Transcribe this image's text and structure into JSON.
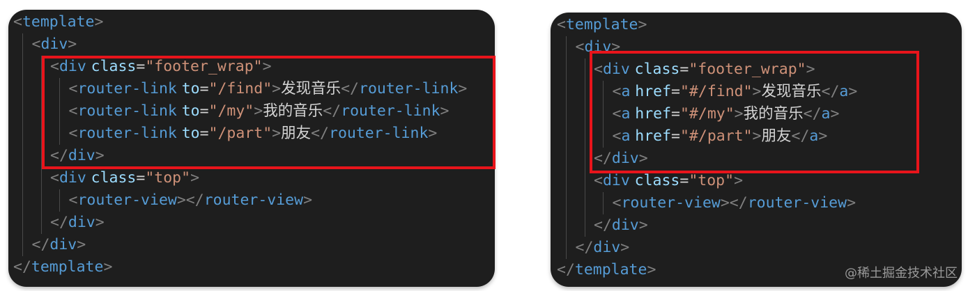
{
  "panels": {
    "left": {
      "lines": [
        {
          "indent": 0,
          "tokens": [
            {
              "t": "tag-bracket",
              "v": "<"
            },
            {
              "t": "tag-name",
              "v": "template"
            },
            {
              "t": "tag-bracket",
              "v": ">"
            }
          ]
        },
        {
          "indent": 1,
          "tokens": [
            {
              "t": "tag-bracket",
              "v": "<"
            },
            {
              "t": "tag-name",
              "v": "div"
            },
            {
              "t": "tag-bracket",
              "v": ">"
            }
          ]
        },
        {
          "indent": 2,
          "tokens": [
            {
              "t": "tag-bracket",
              "v": "<"
            },
            {
              "t": "tag-name",
              "v": "div"
            },
            {
              "t": "text",
              "v": " "
            },
            {
              "t": "attr-name",
              "v": "class"
            },
            {
              "t": "eq",
              "v": "="
            },
            {
              "t": "attr-value",
              "v": "\"footer_wrap\""
            },
            {
              "t": "tag-bracket",
              "v": ">"
            }
          ]
        },
        {
          "indent": 3,
          "tokens": [
            {
              "t": "tag-bracket",
              "v": "<"
            },
            {
              "t": "tag-name",
              "v": "router-link"
            },
            {
              "t": "text",
              "v": " "
            },
            {
              "t": "attr-name",
              "v": "to"
            },
            {
              "t": "eq",
              "v": "="
            },
            {
              "t": "attr-value",
              "v": "\"/find\""
            },
            {
              "t": "tag-bracket",
              "v": ">"
            },
            {
              "t": "text",
              "v": "发现音乐"
            },
            {
              "t": "tag-bracket",
              "v": "</"
            },
            {
              "t": "tag-name",
              "v": "router-link"
            },
            {
              "t": "tag-bracket",
              "v": ">"
            }
          ]
        },
        {
          "indent": 3,
          "tokens": [
            {
              "t": "tag-bracket",
              "v": "<"
            },
            {
              "t": "tag-name",
              "v": "router-link"
            },
            {
              "t": "text",
              "v": " "
            },
            {
              "t": "attr-name",
              "v": "to"
            },
            {
              "t": "eq",
              "v": "="
            },
            {
              "t": "attr-value",
              "v": "\"/my\""
            },
            {
              "t": "tag-bracket",
              "v": ">"
            },
            {
              "t": "text",
              "v": "我的音乐"
            },
            {
              "t": "tag-bracket",
              "v": "</"
            },
            {
              "t": "tag-name",
              "v": "router-link"
            },
            {
              "t": "tag-bracket",
              "v": ">"
            }
          ]
        },
        {
          "indent": 3,
          "tokens": [
            {
              "t": "tag-bracket",
              "v": "<"
            },
            {
              "t": "tag-name",
              "v": "router-link"
            },
            {
              "t": "text",
              "v": " "
            },
            {
              "t": "attr-name",
              "v": "to"
            },
            {
              "t": "eq",
              "v": "="
            },
            {
              "t": "attr-value",
              "v": "\"/part\""
            },
            {
              "t": "tag-bracket",
              "v": ">"
            },
            {
              "t": "text",
              "v": "朋友"
            },
            {
              "t": "tag-bracket",
              "v": "</"
            },
            {
              "t": "tag-name",
              "v": "router-link"
            },
            {
              "t": "tag-bracket",
              "v": ">"
            }
          ]
        },
        {
          "indent": 2,
          "tokens": [
            {
              "t": "tag-bracket",
              "v": "</"
            },
            {
              "t": "tag-name",
              "v": "div"
            },
            {
              "t": "tag-bracket",
              "v": ">"
            }
          ]
        },
        {
          "indent": 2,
          "tokens": [
            {
              "t": "tag-bracket",
              "v": "<"
            },
            {
              "t": "tag-name",
              "v": "div"
            },
            {
              "t": "text",
              "v": " "
            },
            {
              "t": "attr-name",
              "v": "class"
            },
            {
              "t": "eq",
              "v": "="
            },
            {
              "t": "attr-value",
              "v": "\"top\""
            },
            {
              "t": "tag-bracket",
              "v": ">"
            }
          ]
        },
        {
          "indent": 3,
          "tokens": [
            {
              "t": "tag-bracket",
              "v": "<"
            },
            {
              "t": "tag-name",
              "v": "router-view"
            },
            {
              "t": "tag-bracket",
              "v": "></"
            },
            {
              "t": "tag-name",
              "v": "router-view"
            },
            {
              "t": "tag-bracket",
              "v": ">"
            }
          ]
        },
        {
          "indent": 2,
          "tokens": [
            {
              "t": "tag-bracket",
              "v": "</"
            },
            {
              "t": "tag-name",
              "v": "div"
            },
            {
              "t": "tag-bracket",
              "v": ">"
            }
          ]
        },
        {
          "indent": 1,
          "tokens": [
            {
              "t": "tag-bracket",
              "v": "</"
            },
            {
              "t": "tag-name",
              "v": "div"
            },
            {
              "t": "tag-bracket",
              "v": ">"
            }
          ]
        },
        {
          "indent": 0,
          "tokens": [
            {
              "t": "tag-bracket",
              "v": "</"
            },
            {
              "t": "tag-name",
              "v": "template"
            },
            {
              "t": "tag-bracket",
              "v": ">"
            }
          ]
        }
      ]
    },
    "right": {
      "lines": [
        {
          "indent": 0,
          "tokens": [
            {
              "t": "tag-bracket",
              "v": "<"
            },
            {
              "t": "tag-name",
              "v": "template"
            },
            {
              "t": "tag-bracket",
              "v": ">"
            }
          ]
        },
        {
          "indent": 1,
          "tokens": [
            {
              "t": "tag-bracket",
              "v": "<"
            },
            {
              "t": "tag-name",
              "v": "div"
            },
            {
              "t": "tag-bracket",
              "v": ">"
            }
          ]
        },
        {
          "indent": 2,
          "tokens": [
            {
              "t": "tag-bracket",
              "v": "<"
            },
            {
              "t": "tag-name",
              "v": "div"
            },
            {
              "t": "text",
              "v": " "
            },
            {
              "t": "attr-name",
              "v": "class"
            },
            {
              "t": "eq",
              "v": "="
            },
            {
              "t": "attr-value",
              "v": "\"footer_wrap\""
            },
            {
              "t": "tag-bracket",
              "v": ">"
            }
          ]
        },
        {
          "indent": 3,
          "tokens": [
            {
              "t": "tag-bracket",
              "v": "<"
            },
            {
              "t": "tag-name",
              "v": "a"
            },
            {
              "t": "text",
              "v": " "
            },
            {
              "t": "attr-name",
              "v": "href"
            },
            {
              "t": "eq",
              "v": "="
            },
            {
              "t": "attr-value",
              "v": "\"#/find\""
            },
            {
              "t": "tag-bracket",
              "v": ">"
            },
            {
              "t": "text",
              "v": "发现音乐"
            },
            {
              "t": "tag-bracket",
              "v": "</"
            },
            {
              "t": "tag-name",
              "v": "a"
            },
            {
              "t": "tag-bracket",
              "v": ">"
            }
          ]
        },
        {
          "indent": 3,
          "tokens": [
            {
              "t": "tag-bracket",
              "v": "<"
            },
            {
              "t": "tag-name",
              "v": "a"
            },
            {
              "t": "text",
              "v": " "
            },
            {
              "t": "attr-name",
              "v": "href"
            },
            {
              "t": "eq",
              "v": "="
            },
            {
              "t": "attr-value",
              "v": "\"#/my\""
            },
            {
              "t": "tag-bracket",
              "v": ">"
            },
            {
              "t": "text",
              "v": "我的音乐"
            },
            {
              "t": "tag-bracket",
              "v": "</"
            },
            {
              "t": "tag-name",
              "v": "a"
            },
            {
              "t": "tag-bracket",
              "v": ">"
            }
          ]
        },
        {
          "indent": 3,
          "tokens": [
            {
              "t": "tag-bracket",
              "v": "<"
            },
            {
              "t": "tag-name",
              "v": "a"
            },
            {
              "t": "text",
              "v": " "
            },
            {
              "t": "attr-name",
              "v": "href"
            },
            {
              "t": "eq",
              "v": "="
            },
            {
              "t": "attr-value",
              "v": "\"#/part\""
            },
            {
              "t": "tag-bracket",
              "v": ">"
            },
            {
              "t": "text",
              "v": "朋友"
            },
            {
              "t": "tag-bracket",
              "v": "</"
            },
            {
              "t": "tag-name",
              "v": "a"
            },
            {
              "t": "tag-bracket",
              "v": ">"
            }
          ]
        },
        {
          "indent": 2,
          "tokens": [
            {
              "t": "tag-bracket",
              "v": "</"
            },
            {
              "t": "tag-name",
              "v": "div"
            },
            {
              "t": "tag-bracket",
              "v": ">"
            }
          ]
        },
        {
          "indent": 2,
          "tokens": [
            {
              "t": "tag-bracket",
              "v": "<"
            },
            {
              "t": "tag-name",
              "v": "div"
            },
            {
              "t": "text",
              "v": " "
            },
            {
              "t": "attr-name",
              "v": "class"
            },
            {
              "t": "eq",
              "v": "="
            },
            {
              "t": "attr-value",
              "v": "\"top\""
            },
            {
              "t": "tag-bracket",
              "v": ">"
            }
          ]
        },
        {
          "indent": 3,
          "tokens": [
            {
              "t": "tag-bracket",
              "v": "<"
            },
            {
              "t": "tag-name",
              "v": "router-view"
            },
            {
              "t": "tag-bracket",
              "v": "></"
            },
            {
              "t": "tag-name",
              "v": "router-view"
            },
            {
              "t": "tag-bracket",
              "v": ">"
            }
          ]
        },
        {
          "indent": 2,
          "tokens": [
            {
              "t": "tag-bracket",
              "v": "</"
            },
            {
              "t": "tag-name",
              "v": "div"
            },
            {
              "t": "tag-bracket",
              "v": ">"
            }
          ]
        },
        {
          "indent": 1,
          "tokens": [
            {
              "t": "tag-bracket",
              "v": "</"
            },
            {
              "t": "tag-name",
              "v": "div"
            },
            {
              "t": "tag-bracket",
              "v": ">"
            }
          ]
        },
        {
          "indent": 0,
          "tokens": [
            {
              "t": "tag-bracket",
              "v": "</"
            },
            {
              "t": "tag-name",
              "v": "template"
            },
            {
              "t": "tag-bracket",
              "v": ">"
            }
          ]
        }
      ]
    }
  },
  "watermark": "@稀土掘金技术社区",
  "colors": {
    "editor_background": "#1e1e1e",
    "highlight_border": "#e8141b",
    "tag_bracket": "#808080",
    "tag_name": "#569cd6",
    "attr_name": "#9cdcfe",
    "attr_value": "#ce9178",
    "text": "#d4d4d4"
  }
}
